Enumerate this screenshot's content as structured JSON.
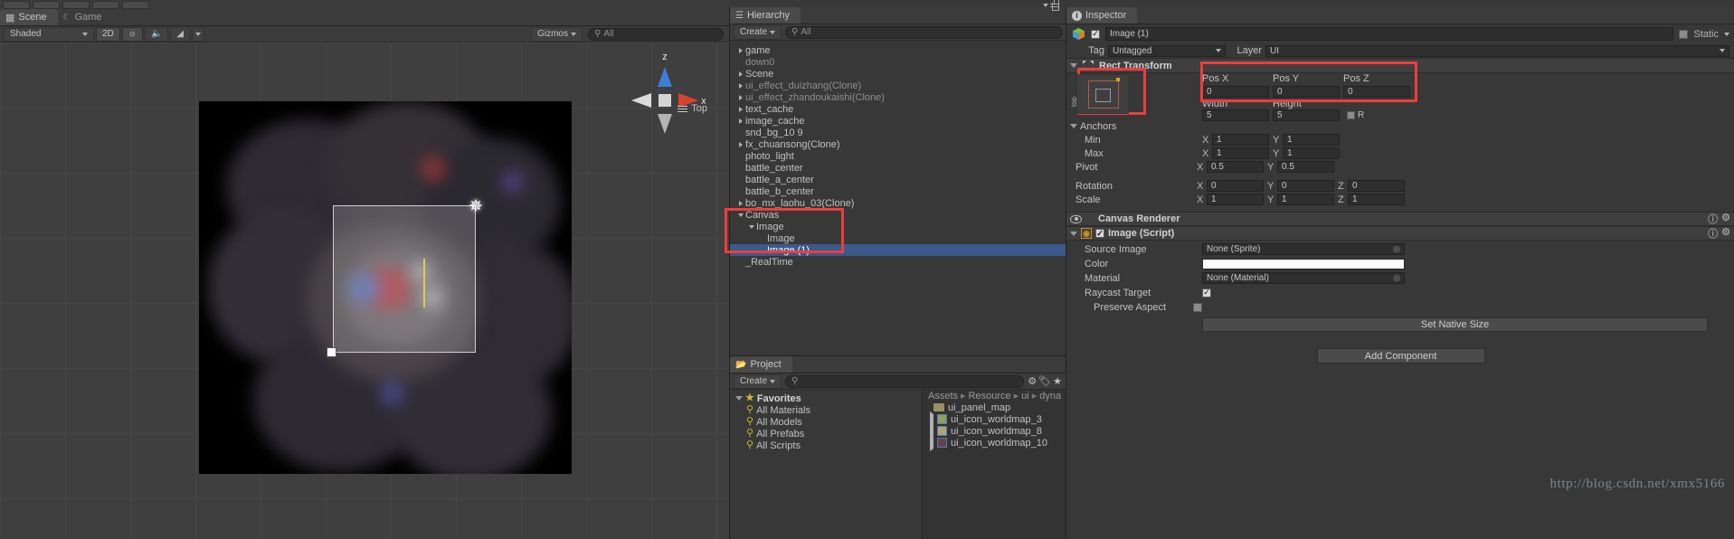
{
  "scene": {
    "tabs": [
      {
        "label": "Scene",
        "icon": "grid-icon",
        "active": true
      },
      {
        "label": "Game",
        "icon": "gamepad-icon",
        "active": false
      }
    ],
    "toolbar": {
      "shading": "Shaded",
      "mode_2d": "2D",
      "light_icon": "sun-icon",
      "audio_icon": "speaker-icon",
      "fx_icon": "image-icon",
      "gizmos": "Gizmos",
      "search_placeholder": "All"
    },
    "gizmo": {
      "axis_z": "z",
      "axis_x": "x",
      "view_label": "Top"
    }
  },
  "hierarchy": {
    "tab": "Hierarchy",
    "tab_icon": "hierarchy-icon",
    "create_label": "Create",
    "search_placeholder": "All",
    "items": [
      {
        "label": "game",
        "depth": 0,
        "expand": "collapsed",
        "dim": false,
        "selected": false
      },
      {
        "label": "down0",
        "depth": 0,
        "expand": "none",
        "dim": true,
        "selected": false
      },
      {
        "label": "Scene",
        "depth": 0,
        "expand": "collapsed",
        "dim": false,
        "selected": false
      },
      {
        "label": "ui_effect_duizhang(Clone)",
        "depth": 0,
        "expand": "collapsed",
        "dim": true,
        "selected": false
      },
      {
        "label": "ui_effect_zhandoukaishi(Clone)",
        "depth": 0,
        "expand": "collapsed",
        "dim": true,
        "selected": false
      },
      {
        "label": "text_cache",
        "depth": 0,
        "expand": "collapsed",
        "dim": false,
        "selected": false
      },
      {
        "label": "image_cache",
        "depth": 0,
        "expand": "collapsed",
        "dim": false,
        "selected": false
      },
      {
        "label": "snd_bg_10 9",
        "depth": 0,
        "expand": "none",
        "dim": false,
        "selected": false
      },
      {
        "label": "fx_chuansong(Clone)",
        "depth": 0,
        "expand": "collapsed",
        "dim": false,
        "selected": false
      },
      {
        "label": "photo_light",
        "depth": 0,
        "expand": "none",
        "dim": false,
        "selected": false
      },
      {
        "label": "battle_center",
        "depth": 0,
        "expand": "none",
        "dim": false,
        "selected": false
      },
      {
        "label": "battle_a_center",
        "depth": 0,
        "expand": "none",
        "dim": false,
        "selected": false
      },
      {
        "label": "battle_b_center",
        "depth": 0,
        "expand": "none",
        "dim": false,
        "selected": false
      },
      {
        "label": "bo_mx_laohu_03(Clone)",
        "depth": 0,
        "expand": "collapsed",
        "dim": false,
        "selected": false
      },
      {
        "label": "Canvas",
        "depth": 0,
        "expand": "expanded",
        "dim": false,
        "selected": false
      },
      {
        "label": "Image",
        "depth": 1,
        "expand": "expanded",
        "dim": false,
        "selected": false
      },
      {
        "label": "Image",
        "depth": 2,
        "expand": "none",
        "dim": false,
        "selected": false
      },
      {
        "label": "Image (1)",
        "depth": 2,
        "expand": "none",
        "dim": false,
        "selected": true
      },
      {
        "label": "_RealTime",
        "depth": 0,
        "expand": "none",
        "dim": false,
        "selected": false
      }
    ]
  },
  "project": {
    "tab": "Project",
    "tab_icon": "folder-icon",
    "create_label": "Create",
    "search_placeholder": "",
    "favorites_label": "Favorites",
    "favorites": [
      {
        "label": "All Materials",
        "icon": "search-icon"
      },
      {
        "label": "All Models",
        "icon": "search-icon"
      },
      {
        "label": "All Prefabs",
        "icon": "search-icon"
      },
      {
        "label": "All Scripts",
        "icon": "search-icon"
      }
    ],
    "breadcrumb": [
      "Assets",
      "Resource",
      "ui",
      "dyna"
    ],
    "assets": [
      {
        "label": "ui_panel_map",
        "icon": "folder-icon",
        "expandable": false
      },
      {
        "label": "ui_icon_worldmap_3",
        "icon": "texture-icon",
        "expandable": true
      },
      {
        "label": "ui_icon_worldmap_8",
        "icon": "texture-icon",
        "expandable": true
      },
      {
        "label": "ui_icon_worldmap_10",
        "icon": "texture-icon",
        "expandable": true
      }
    ]
  },
  "inspector": {
    "tab": "Inspector",
    "tab_icon": "info-icon",
    "object_name": "Image (1)",
    "object_enabled": true,
    "static_label": "Static",
    "tag_label": "Tag",
    "tag_value": "Untagged",
    "layer_label": "Layer",
    "layer_value": "UI",
    "rect_transform": {
      "title": "Rect Transform",
      "anchor_preset_top": "right",
      "anchor_preset_side": "top",
      "columns": [
        "Pos X",
        "Pos Y",
        "Pos Z"
      ],
      "pos": [
        "0",
        "0",
        "0"
      ],
      "size_columns": [
        "Width",
        "Height"
      ],
      "size": [
        "5",
        "5"
      ],
      "blueprint_label": "R",
      "anchors_label": "Anchors",
      "min_label": "Min",
      "min": {
        "x": "1",
        "y": "1"
      },
      "max_label": "Max",
      "max": {
        "x": "1",
        "y": "1"
      },
      "pivot_label": "Pivot",
      "pivot": {
        "x": "0.5",
        "y": "0.5"
      },
      "rotation_label": "Rotation",
      "rotation": {
        "x": "0",
        "y": "0",
        "z": "0"
      },
      "scale_label": "Scale",
      "scale": {
        "x": "1",
        "y": "1",
        "z": "1"
      }
    },
    "canvas_renderer": {
      "title": "Canvas Renderer",
      "icon": "eye-icon"
    },
    "image_script": {
      "title": "Image (Script)",
      "enabled": true,
      "source_image_label": "Source Image",
      "source_image_value": "None (Sprite)",
      "color_label": "Color",
      "color_value": "#FFFFFF",
      "material_label": "Material",
      "material_value": "None (Material)",
      "raycast_target_label": "Raycast Target",
      "raycast_target": true,
      "preserve_aspect_label": "Preserve Aspect",
      "preserve_aspect": false,
      "set_native_size_label": "Set Native Size"
    },
    "add_component_label": "Add Component"
  },
  "watermark": "http://blog.csdn.net/xmx5166",
  "colors": {
    "selection_blue": "#3a5a8c",
    "annotation_red": "#f03c3c",
    "favorites_gold": "#d8b226",
    "accent_orange": "#e0a020"
  }
}
